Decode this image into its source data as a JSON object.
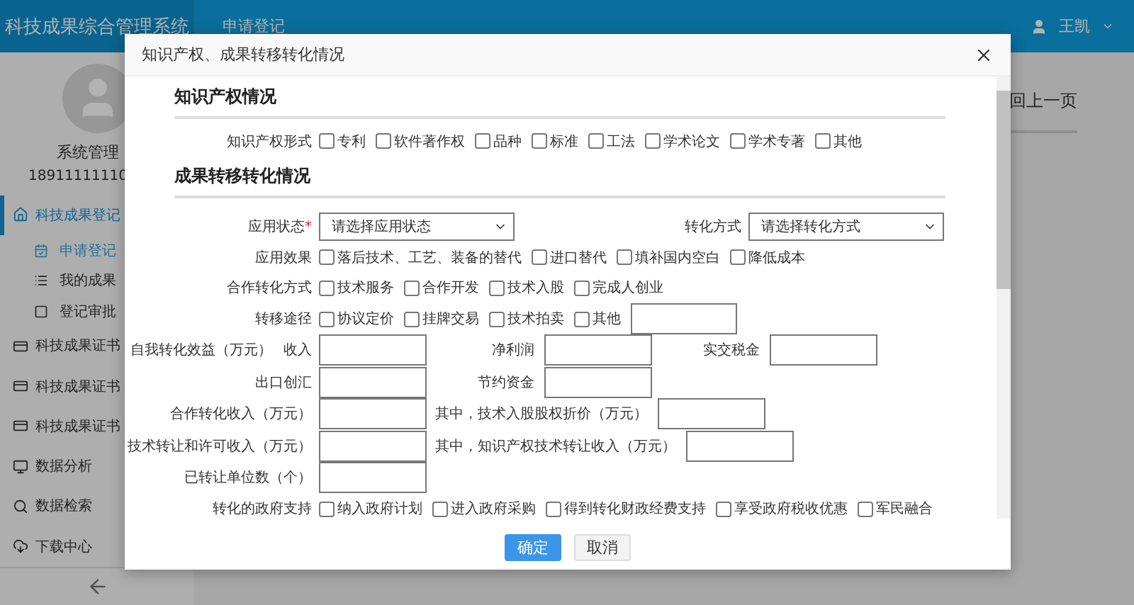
{
  "header": {
    "brand": "科技成果综合管理系统",
    "tab": "申请登记",
    "user": "王凯"
  },
  "sidebar": {
    "user_name": "系统管理",
    "phone": "18911111110",
    "nav": [
      {
        "label": "科技成果登记",
        "selected": true,
        "children": [
          {
            "label": "申请登记",
            "selected": true
          },
          {
            "label": "我的成果",
            "selected": false
          },
          {
            "label": "登记审批",
            "selected": false
          }
        ]
      },
      {
        "label": "科技成果证书",
        "selected": false
      },
      {
        "label": "科技成果证书",
        "selected": false
      },
      {
        "label": "科技成果证书",
        "selected": false
      },
      {
        "label": "数据分析",
        "selected": false
      },
      {
        "label": "数据检索",
        "selected": false
      },
      {
        "label": "下载中心",
        "selected": false
      }
    ]
  },
  "main": {
    "back_link": "回上一页"
  },
  "dialog": {
    "title": "知识产权、成果转移转化情况",
    "sections": [
      {
        "heading": "知识产权情况",
        "rows": [
          {
            "kind": "checkboxes",
            "label": "知识产权形式",
            "options": [
              {
                "label": "专利",
                "checked": false
              },
              {
                "label": "软件著作权",
                "checked": false
              },
              {
                "label": "品种",
                "checked": false
              },
              {
                "label": "标准",
                "checked": false
              },
              {
                "label": "工法",
                "checked": false
              },
              {
                "label": "学术论文",
                "checked": false
              },
              {
                "label": "学术专著",
                "checked": false
              },
              {
                "label": "其他",
                "checked": false
              }
            ]
          }
        ]
      },
      {
        "heading": "成果转移转化情况",
        "rows": [
          {
            "kind": "selects",
            "items": [
              {
                "label": "应用状态",
                "required_mark": "*",
                "value": "请选择应用状态"
              },
              {
                "label": "转化方式",
                "value": "请选择转化方式"
              }
            ]
          },
          {
            "kind": "checkboxes",
            "label": "应用效果",
            "options": [
              {
                "label": "落后技术、工艺、装备的替代",
                "checked": false
              },
              {
                "label": "进口替代",
                "checked": false
              },
              {
                "label": "填补国内空白",
                "checked": false
              },
              {
                "label": "降低成本",
                "checked": false
              }
            ]
          },
          {
            "kind": "checkboxes",
            "label": "合作转化方式",
            "options": [
              {
                "label": "技术服务",
                "checked": false
              },
              {
                "label": "合作开发",
                "checked": false
              },
              {
                "label": "技术入股",
                "checked": false
              },
              {
                "label": "完成人创业",
                "checked": false
              }
            ]
          },
          {
            "kind": "checkboxes",
            "label": "转移途径",
            "other_field": true,
            "options": [
              {
                "label": "协议定价",
                "checked": false
              },
              {
                "label": "挂牌交易",
                "checked": false
              },
              {
                "label": "技术拍卖",
                "checked": false
              },
              {
                "label": "其他",
                "checked": false
              }
            ]
          },
          {
            "kind": "fields",
            "items": [
              {
                "label": "自我转化效益（万元）",
                "sublabel": "收入"
              },
              {
                "label": "净利润"
              },
              {
                "label": "实交税金"
              }
            ]
          },
          {
            "kind": "fields",
            "items": [
              {
                "label": "出口创汇"
              },
              {
                "label": "节约资金"
              }
            ]
          },
          {
            "kind": "fields",
            "items": [
              {
                "label": "合作转化收入（万元）"
              },
              {
                "label": "其中，技术入股股权折价（万元）"
              }
            ]
          },
          {
            "kind": "fields",
            "items": [
              {
                "label": "技术转让和许可收入（万元）"
              },
              {
                "label": "其中，知识产权技术转让收入（万元）"
              }
            ]
          },
          {
            "kind": "fields",
            "items": [
              {
                "label": "已转让单位数（个）"
              }
            ]
          },
          {
            "kind": "checkboxes",
            "label": "转化的政府支持",
            "options": [
              {
                "label": "纳入政府计划",
                "checked": false
              },
              {
                "label": "进入政府采购",
                "checked": false
              },
              {
                "label": "得到转化财政经费支持",
                "checked": false
              },
              {
                "label": "享受政府税收优惠",
                "checked": false
              },
              {
                "label": "军民融合",
                "checked": false
              }
            ]
          }
        ]
      }
    ],
    "buttons": [
      {
        "label": "确定",
        "primary": true
      },
      {
        "label": "取消",
        "primary": false
      }
    ]
  }
}
